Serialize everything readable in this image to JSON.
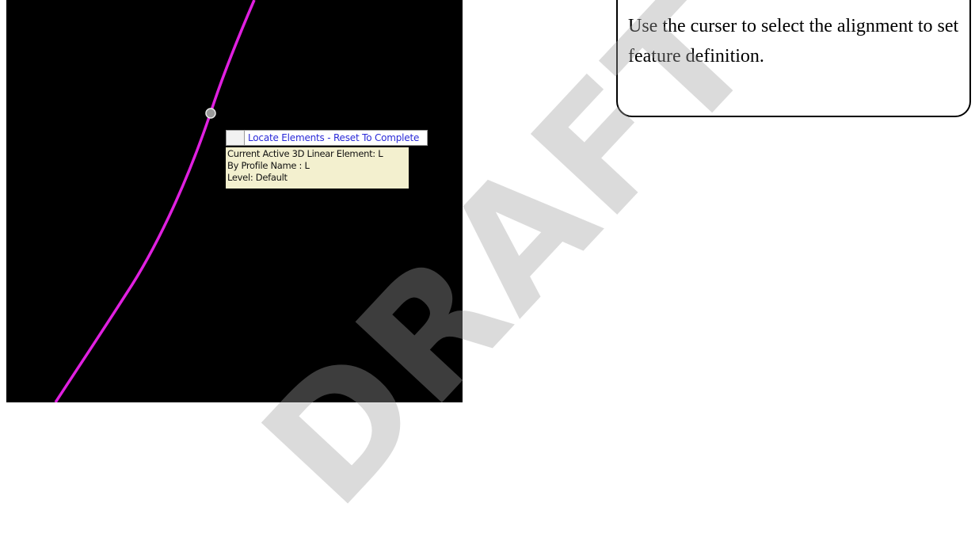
{
  "viewport": {
    "background_color": "#000000",
    "alignment_color": "#e020e0",
    "snap_point": "circle-snap-icon"
  },
  "prompt": {
    "text": "Locate Elements - Reset To Complete",
    "text_color": "#2a2ad8"
  },
  "tooltip": {
    "background_color": "#f3f0cf",
    "lines": [
      "Current Active 3D Linear Element: L",
      "By Profile Name : L",
      "Level: Default"
    ]
  },
  "callout": {
    "text": "Use the curser to select the alignment to set feature definition."
  },
  "watermark": {
    "text": "DRAFT"
  }
}
